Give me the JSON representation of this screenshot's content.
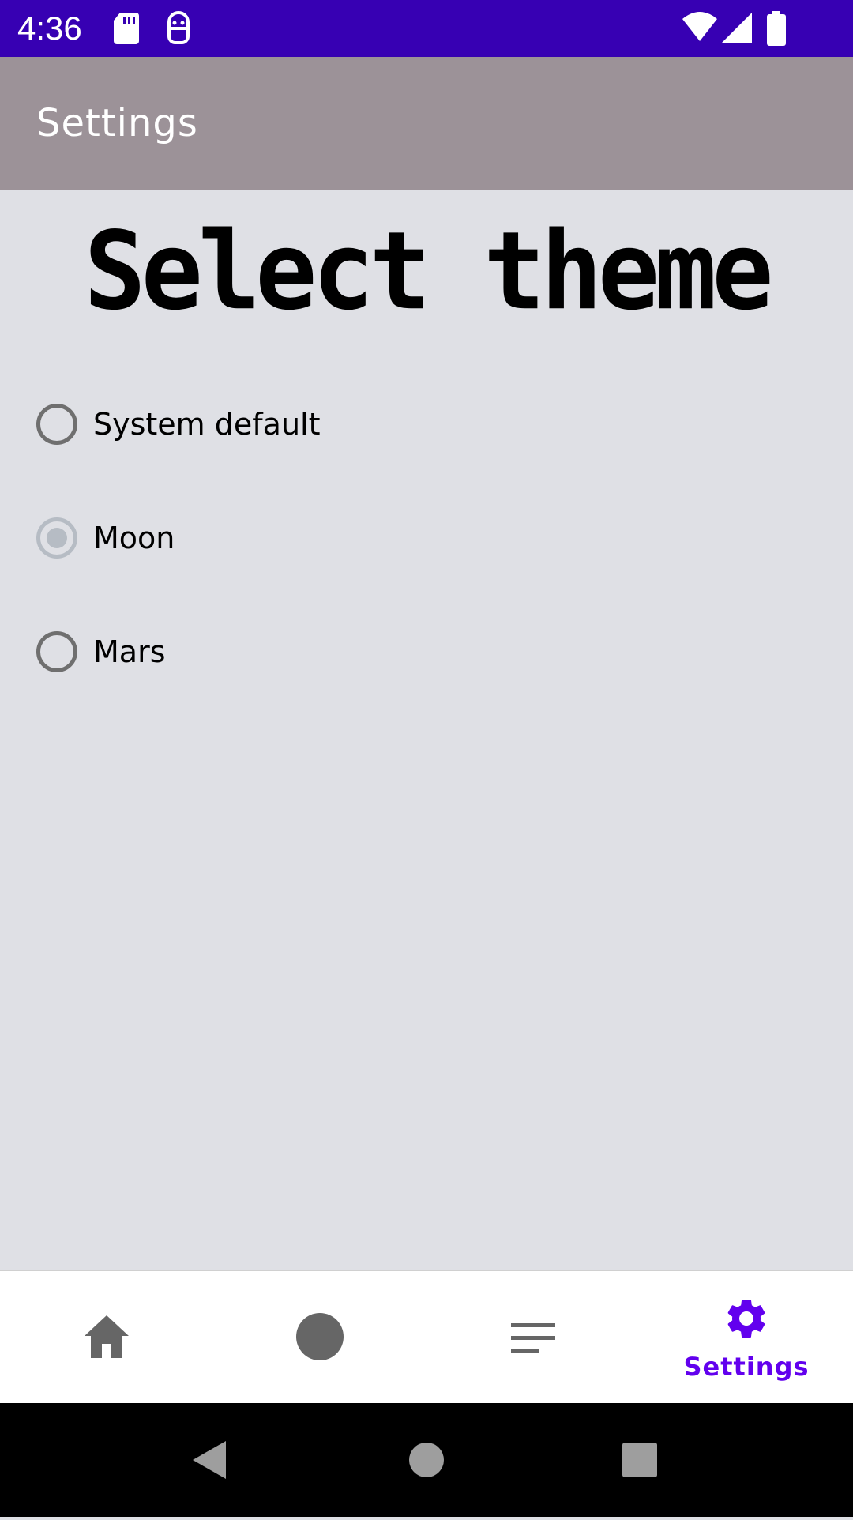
{
  "status_bar": {
    "time": "4:36",
    "icons": [
      "sd-card-icon",
      "android-robot-icon",
      "wifi-icon",
      "cellular-signal-icon",
      "battery-icon"
    ],
    "background": "#3700b3"
  },
  "app_bar": {
    "title": "Settings",
    "background": "#9c9298"
  },
  "content": {
    "heading": "Select theme",
    "options": [
      {
        "label": "System default",
        "checked": false
      },
      {
        "label": "Moon",
        "checked": true
      },
      {
        "label": "Mars",
        "checked": false
      }
    ]
  },
  "bottom_nav": {
    "items": [
      {
        "icon": "home-icon",
        "label": "",
        "active": false
      },
      {
        "icon": "circle-icon",
        "label": "",
        "active": false
      },
      {
        "icon": "list-icon",
        "label": "",
        "active": false
      },
      {
        "icon": "gear-icon",
        "label": "Settings",
        "active": true
      }
    ],
    "active_color": "#6200ee",
    "inactive_color": "#666666"
  },
  "system_nav": {
    "icons": [
      "back-icon",
      "home-button-icon",
      "recents-icon"
    ]
  }
}
